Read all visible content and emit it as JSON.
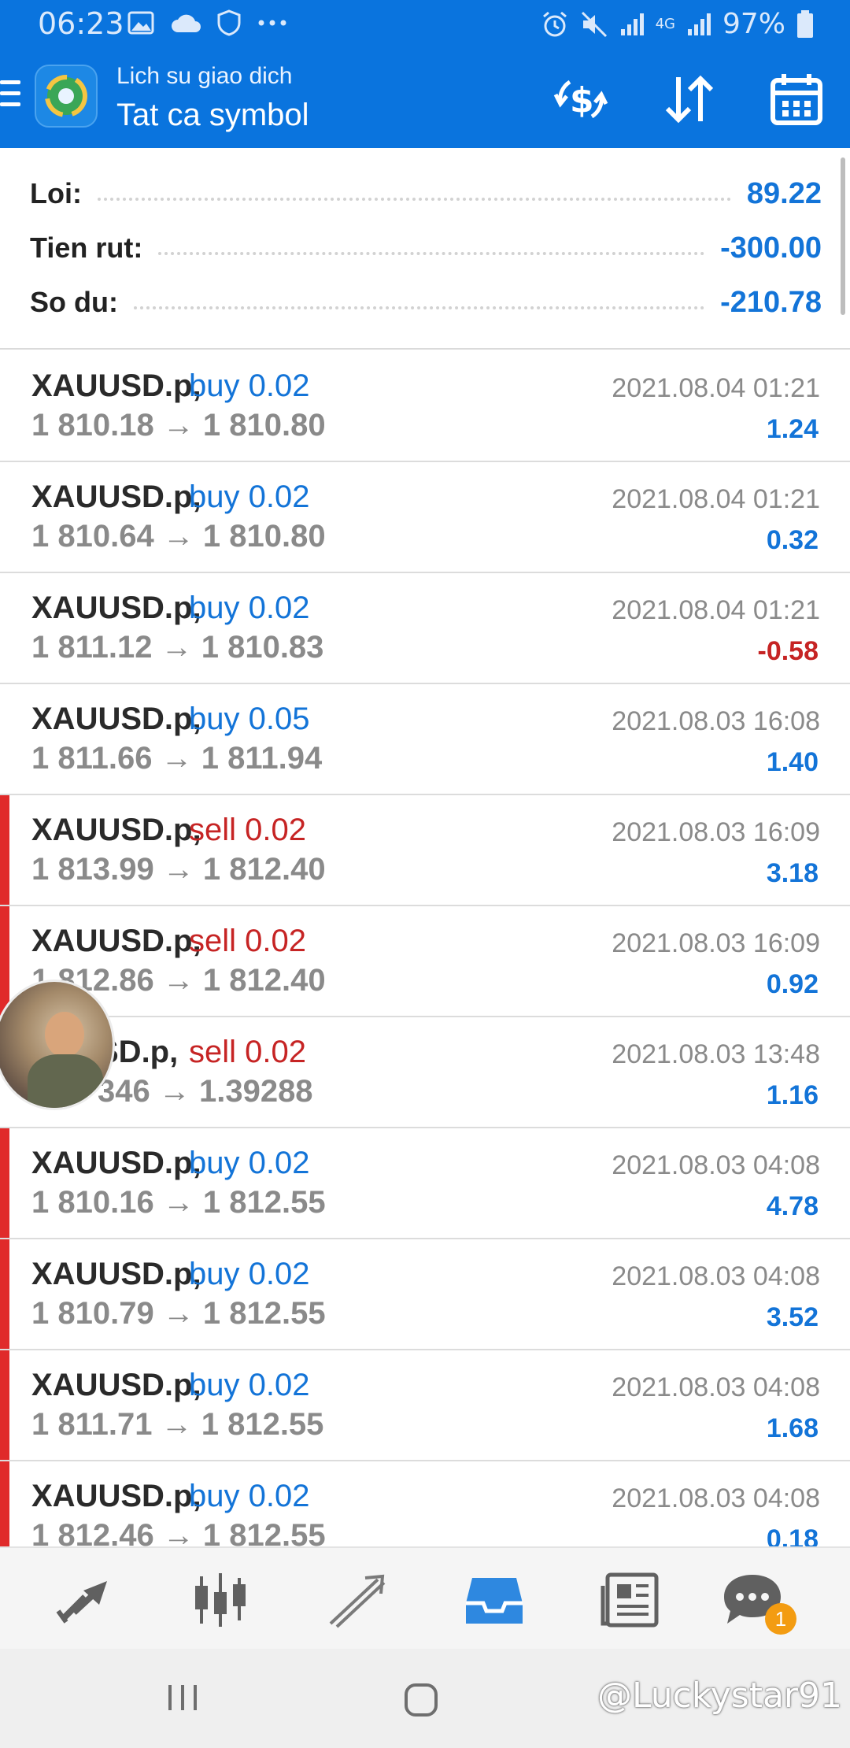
{
  "status_bar": {
    "time": "06:23",
    "network": "4G",
    "battery": "97%"
  },
  "header": {
    "subtitle": "Lich su giao dich",
    "title": "Tat ca symbol"
  },
  "summary": [
    {
      "label": "Loi:",
      "value": "89.22"
    },
    {
      "label": "Tien rut:",
      "value": "-300.00"
    },
    {
      "label": "So du:",
      "value": "-210.78"
    }
  ],
  "deals": [
    {
      "symbol": "XAUUSD.p,",
      "type": "buy 0.02",
      "prices": "1 810.18 → 1 810.80",
      "time": "2021.08.04 01:21",
      "profit": "1.24"
    },
    {
      "symbol": "XAUUSD.p,",
      "type": "buy 0.02",
      "prices": "1 810.64 → 1 810.80",
      "time": "2021.08.04 01:21",
      "profit": "0.32"
    },
    {
      "symbol": "XAUUSD.p,",
      "type": "buy 0.02",
      "prices": "1 811.12 → 1 810.83",
      "time": "2021.08.04 01:21",
      "profit": "-0.58"
    },
    {
      "symbol": "XAUUSD.p,",
      "type": "buy 0.05",
      "prices": "1 811.66 → 1 811.94",
      "time": "2021.08.03 16:08",
      "profit": "1.40"
    },
    {
      "symbol": "XAUUSD.p,",
      "type": "sell 0.02",
      "prices": "1 813.99 → 1 812.40",
      "time": "2021.08.03 16:09",
      "profit": "3.18"
    },
    {
      "symbol": "XAUUSD.p,",
      "type": "sell 0.02",
      "prices": "1 812.86 → 1 812.40",
      "time": "2021.08.03 16:09",
      "profit": "0.92"
    },
    {
      "symbol": "SD.p,",
      "type": "sell 0.02",
      "prices": "346 → 1.39288",
      "time": "2021.08.03 13:48",
      "profit": "1.16"
    },
    {
      "symbol": "XAUUSD.p,",
      "type": "buy 0.02",
      "prices": "1 810.16 → 1 812.55",
      "time": "2021.08.03 04:08",
      "profit": "4.78"
    },
    {
      "symbol": "XAUUSD.p,",
      "type": "buy 0.02",
      "prices": "1 810.79 → 1 812.55",
      "time": "2021.08.03 04:08",
      "profit": "3.52"
    },
    {
      "symbol": "XAUUSD.p,",
      "type": "buy 0.02",
      "prices": "1 811.71 → 1 812.55",
      "time": "2021.08.03 04:08",
      "profit": "1.68"
    },
    {
      "symbol": "XAUUSD.p,",
      "type": "buy 0.02",
      "prices": "1 812.46 → 1 812.55",
      "time": "2021.08.03 04:08",
      "profit": "0.18"
    }
  ],
  "bottom_nav": {
    "chat_badge": "1"
  },
  "watermark": "@Luckystar91",
  "colors": {
    "primary": "#0a74de",
    "buy": "#1374d8",
    "sell": "#c62424",
    "marker": "#e02a2a",
    "badge": "#f39c12"
  }
}
